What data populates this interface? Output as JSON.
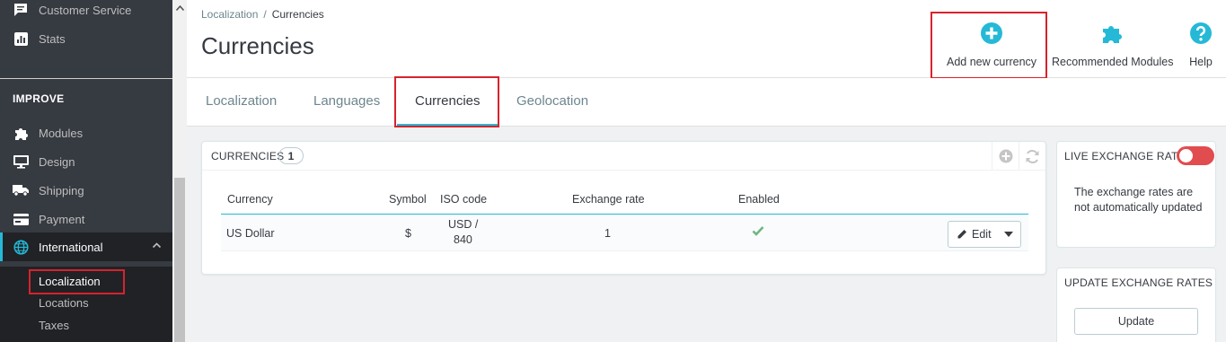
{
  "sidebar": {
    "items_top": [
      {
        "label": "Customer Service",
        "icon": "chat-icon"
      },
      {
        "label": "Stats",
        "icon": "stats-icon"
      }
    ],
    "section_title": "IMPROVE",
    "items": [
      {
        "label": "Modules",
        "icon": "puzzle-icon"
      },
      {
        "label": "Design",
        "icon": "monitor-icon"
      },
      {
        "label": "Shipping",
        "icon": "truck-icon"
      },
      {
        "label": "Payment",
        "icon": "credit-card-icon"
      },
      {
        "label": "International",
        "icon": "globe-icon"
      }
    ],
    "subitems": [
      "Localization",
      "Locations",
      "Taxes"
    ]
  },
  "header": {
    "breadcrumb": [
      "Localization",
      "Currencies"
    ],
    "breadcrumb_sep": "/",
    "title": "Currencies",
    "toolbar": {
      "add_label": "Add new currency",
      "modules_label": "Recommended Modules",
      "help_label": "Help"
    }
  },
  "tabs": [
    "Localization",
    "Languages",
    "Currencies",
    "Geolocation"
  ],
  "currencies_panel": {
    "title": "CURRENCIES",
    "count": "1",
    "columns": [
      "Currency",
      "Symbol",
      "ISO code",
      "Exchange rate",
      "Enabled"
    ],
    "rows": [
      {
        "currency": "US Dollar",
        "symbol": "$",
        "iso_line1": "USD /",
        "iso_line2": "840",
        "rate": "1",
        "enabled": true
      }
    ],
    "edit_label": "Edit"
  },
  "live_rates": {
    "title": "LIVE EXCHANGE RATES",
    "text": "The exchange rates are not automatically updated",
    "enabled": false
  },
  "update_rates": {
    "title": "UPDATE EXCHANGE RATES",
    "button": "Update"
  },
  "colors": {
    "accent": "#25b9d7",
    "highlight": "#d6232d",
    "toggle_off": "#e14c4f",
    "success": "#70b580"
  }
}
